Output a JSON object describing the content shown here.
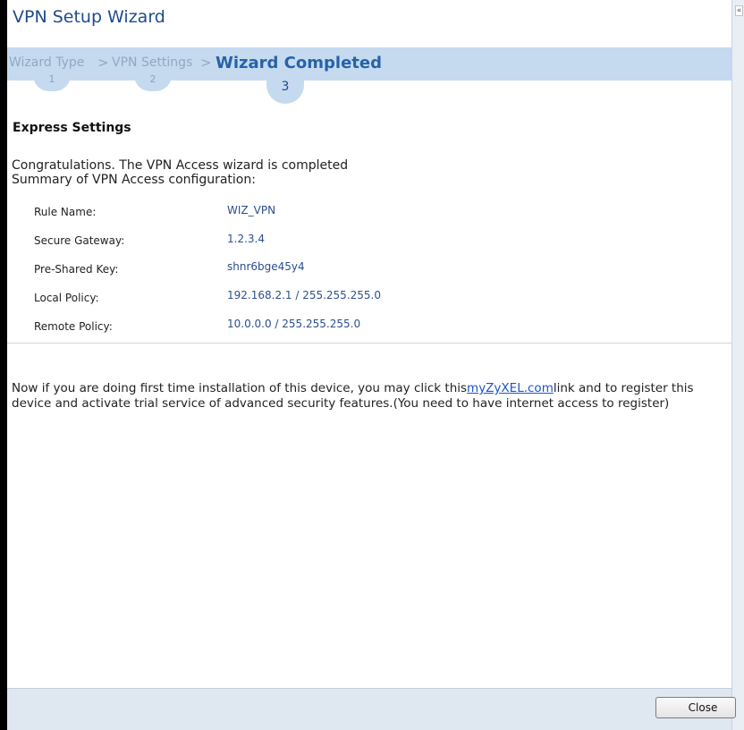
{
  "window": {
    "title": "VPN Setup Wizard"
  },
  "steps": [
    {
      "label": "Wizard Type",
      "number": "1"
    },
    {
      "label": "VPN Settings",
      "number": "2"
    },
    {
      "label": "Wizard Completed",
      "number": "3"
    }
  ],
  "separator": ">",
  "section": {
    "title": "Express Settings",
    "message_line1": "Congratulations. The VPN Access wizard is completed",
    "message_line2": "Summary of VPN Access configuration:"
  },
  "summary": [
    {
      "label": "Rule Name:",
      "value": "WIZ_VPN"
    },
    {
      "label": "Secure Gateway:",
      "value": "1.2.3.4"
    },
    {
      "label": "Pre-Shared Key:",
      "value": "shnr6bge45y4"
    },
    {
      "label": "Local Policy:",
      "value": "192.168.2.1 / 255.255.255.0"
    },
    {
      "label": "Remote Policy:",
      "value": "10.0.0.0 / 255.255.255.0"
    }
  ],
  "note": {
    "before": "Now if you are doing first time installation of this device, you may click this",
    "link": "myZyXEL.com",
    "after": "link and to register this device and activate trial service of advanced security features.(You need to have internet access to register)"
  },
  "footer": {
    "close_label": "Close"
  },
  "colors": {
    "title": "#1f4b8c",
    "step_bar": "#c5daef",
    "active_step": "#2762a7",
    "link": "#1a55c9"
  }
}
